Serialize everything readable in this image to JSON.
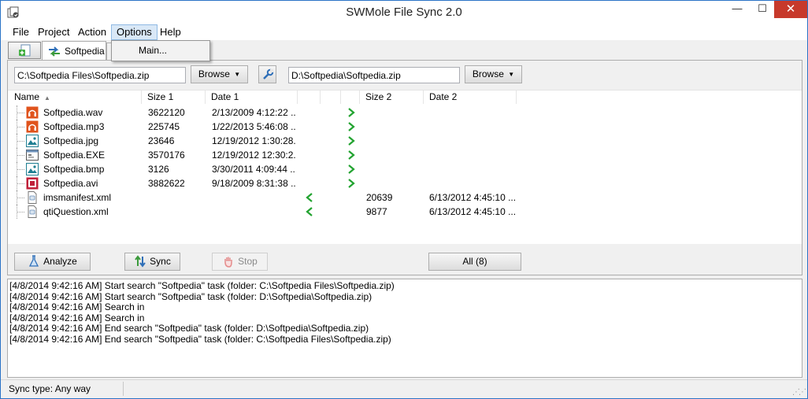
{
  "window": {
    "title": "SWMole File Sync 2.0",
    "controls": {
      "minimize": "—",
      "maximize": "☐",
      "close": "✕"
    }
  },
  "menu": {
    "items": [
      "File",
      "Project",
      "Action",
      "Options",
      "Help"
    ],
    "active": "Options",
    "dropdown": {
      "items": [
        "Main..."
      ]
    }
  },
  "tabs": {
    "items": [
      {
        "label": "Softpedia"
      }
    ]
  },
  "paths": {
    "left_value": "C:\\Softpedia Files\\Softpedia.zip",
    "right_value": "D:\\Softpedia\\Softpedia.zip",
    "browse_label": "Browse"
  },
  "filelist": {
    "columns": [
      "Name",
      "Size 1",
      "Date 1",
      "Size 2",
      "Date 2"
    ],
    "rows": [
      {
        "name": "Softpedia.wav",
        "icon": "audio-file-icon",
        "size1": "3622120",
        "date1": "2/13/2009 4:12:22 ...",
        "size2": "",
        "date2": "",
        "direction": "right"
      },
      {
        "name": "Softpedia.mp3",
        "icon": "audio-file-icon",
        "size1": "225745",
        "date1": "1/22/2013 5:46:08 ...",
        "size2": "",
        "date2": "",
        "direction": "right"
      },
      {
        "name": "Softpedia.jpg",
        "icon": "image-file-icon",
        "size1": "23646",
        "date1": "12/19/2012 1:30:28...",
        "size2": "",
        "date2": "",
        "direction": "right"
      },
      {
        "name": "Softpedia.EXE",
        "icon": "exe-file-icon",
        "size1": "3570176",
        "date1": "12/19/2012 12:30:2...",
        "size2": "",
        "date2": "",
        "direction": "right"
      },
      {
        "name": "Softpedia.bmp",
        "icon": "image-file-icon",
        "size1": "3126",
        "date1": "3/30/2011 4:09:44 ...",
        "size2": "",
        "date2": "",
        "direction": "right"
      },
      {
        "name": "Softpedia.avi",
        "icon": "video-file-icon",
        "size1": "3882622",
        "date1": "9/18/2009 8:31:38 ...",
        "size2": "",
        "date2": "",
        "direction": "right"
      },
      {
        "name": "imsmanifest.xml",
        "icon": "xml-file-icon",
        "size1": "",
        "date1": "",
        "size2": "20639",
        "date2": "6/13/2012 4:45:10 ...",
        "direction": "left"
      },
      {
        "name": "qtiQuestion.xml",
        "icon": "xml-file-icon",
        "size1": "",
        "date1": "",
        "size2": "9877",
        "date2": "6/13/2012 4:45:10 ...",
        "direction": "left"
      }
    ]
  },
  "actions": {
    "analyze": "Analyze",
    "sync": "Sync",
    "stop": "Stop",
    "filter": "All (8)"
  },
  "log": [
    "[4/8/2014 9:42:16 AM] Start search \"Softpedia\" task (folder: C:\\Softpedia Files\\Softpedia.zip)",
    "[4/8/2014 9:42:16 AM] Start search \"Softpedia\" task (folder: D:\\Softpedia\\Softpedia.zip)",
    "[4/8/2014 9:42:16 AM] Search in",
    "[4/8/2014 9:42:16 AM] Search in",
    "[4/8/2014 9:42:16 AM] End search \"Softpedia\" task (folder: D:\\Softpedia\\Softpedia.zip)",
    "[4/8/2014 9:42:16 AM] End search \"Softpedia\" task (folder: C:\\Softpedia Files\\Softpedia.zip)"
  ],
  "status": {
    "sync_type": "Sync type: Any way"
  },
  "colors": {
    "accent": "#2a73c7",
    "close_red": "#c7392b",
    "arrow_green": "#22a330",
    "audio_orange": "#e0531c",
    "image_teal": "#1f7f93",
    "video_red": "#c0213a"
  }
}
